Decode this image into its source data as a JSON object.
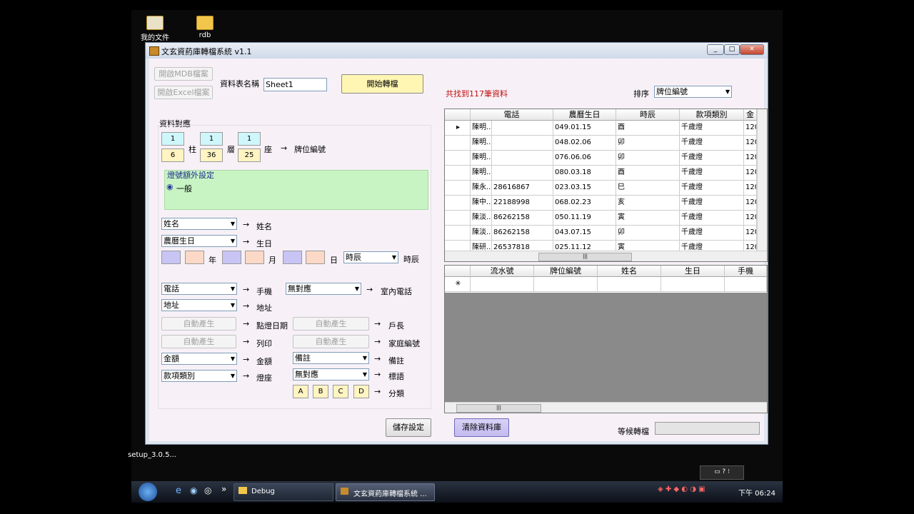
{
  "desktop": {
    "icons": [
      {
        "label": "我的文件"
      },
      {
        "label": "rdb"
      },
      {
        "label": "setup_3.0.5..."
      }
    ]
  },
  "window": {
    "title": "文玄資葯庫轉檔系統 v1.1",
    "buttons": {
      "minimize": "_",
      "maximize": "□",
      "close": "✕"
    }
  },
  "top": {
    "open_mdb": "開啟MDB檔案",
    "open_excel": "開啟Excel檔案",
    "sheet_label": "資料表名稱",
    "sheet_value": "Sheet1",
    "start_label": "開始轉檔",
    "found_text": "共找到117筆資料",
    "sort_label": "排序",
    "sort_value": "牌位編號"
  },
  "mapping": {
    "section_title": "資料對應",
    "top_vals": [
      "1",
      "1",
      "1"
    ],
    "bot_vals": [
      "6",
      "36",
      "25"
    ],
    "col_label": "柱",
    "layer_label": "層",
    "seat_label": "座",
    "target": "牌位編號",
    "arrow": "→",
    "extra_title": "燈號額外設定",
    "radio_label": "一般",
    "name_field": "姓名",
    "name_target": "姓名",
    "birth_field": "農曆生日",
    "birth_target": "生日",
    "year_label": "年",
    "month_label": "月",
    "day_label": "日",
    "hour_field": "時辰",
    "hour_target": "時辰",
    "phone_field": "電話",
    "phone_target": "手機",
    "home_field": "無對應",
    "home_target": "室內電話",
    "addr_field": "地址",
    "addr_target": "地址",
    "auto1": "自動產生",
    "auto1_target": "點燈日期",
    "auto2": "自動產生",
    "auto2_target": "戶長",
    "auto3": "自動產生",
    "auto3_target": "列印",
    "auto4": "自動產生",
    "auto4_target": "家庭編號",
    "amount_field": "金額",
    "amount_target": "金額",
    "note_field": "備註",
    "note_target": "備註",
    "type_field": "款項類別",
    "type_target": "燈座",
    "tag_field": "無對應",
    "tag_target": "標語",
    "cats": [
      "A",
      "B",
      "C",
      "D"
    ],
    "cat_target": "分類",
    "save_label": "儲存設定"
  },
  "grid1": {
    "headers": [
      "電話",
      "農曆生日",
      "時辰",
      "款項類別",
      "金"
    ],
    "rows": [
      [
        "陳明...",
        "",
        "049.01.15",
        "酉",
        "千歲燈",
        "120"
      ],
      [
        "陳明...",
        "",
        "048.02.06",
        "卯",
        "千歲燈",
        "120"
      ],
      [
        "陳明...",
        "",
        "076.06.06",
        "卯",
        "千歲燈",
        "120"
      ],
      [
        "陳明...",
        "",
        "080.03.18",
        "酉",
        "千歲燈",
        "120"
      ],
      [
        "陳永...",
        "28616867",
        "023.03.15",
        "巳",
        "千歲燈",
        "120"
      ],
      [
        "陳中...",
        "22188998",
        "068.02.23",
        "亥",
        "千歲燈",
        "120"
      ],
      [
        "陳淡...",
        "86262158",
        "050.11.19",
        "寅",
        "千歲燈",
        "120"
      ],
      [
        "陳淡...",
        "86262158",
        "043.07.15",
        "卯",
        "千歲燈",
        "120"
      ],
      [
        "陳研...",
        "26537818",
        "025.11.12",
        "寅",
        "千歲燈",
        "120"
      ]
    ],
    "hscroll": "|||"
  },
  "grid2": {
    "headers": [
      "流水號",
      "牌位編號",
      "姓名",
      "生日",
      "手機"
    ],
    "new_row": "✳",
    "hscroll": "|||"
  },
  "bottom": {
    "clear_label": "清除資料庫",
    "wait_label": "等候轉檔"
  },
  "taskbar": {
    "debug_label": "Debug",
    "app_label": "文玄資葯庫轉檔系統 ...",
    "time": "下午 06:24"
  }
}
